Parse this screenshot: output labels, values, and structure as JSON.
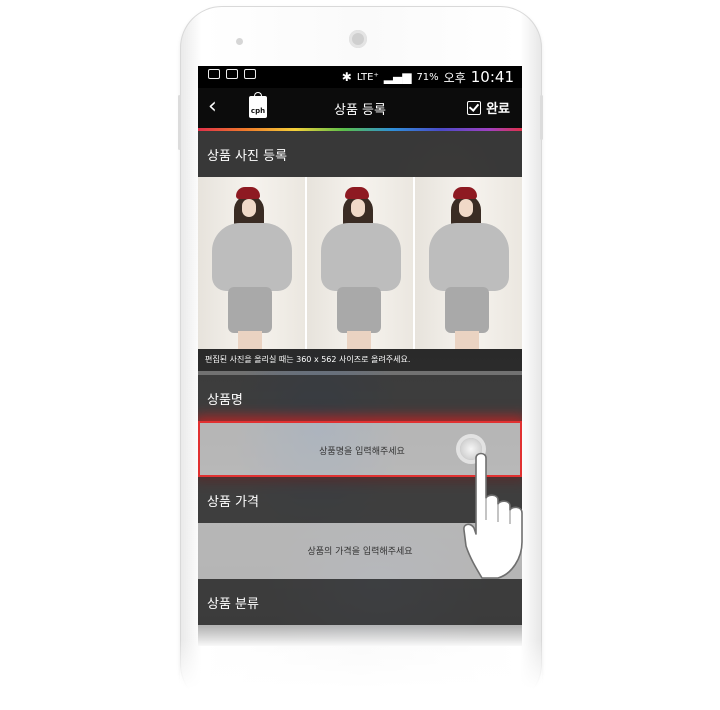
{
  "status_bar": {
    "bluetooth": "✱",
    "network": "LTE⁺",
    "battery": "71%",
    "ampm": "오후",
    "time": "10:41"
  },
  "top_bar": {
    "back_label": "‹",
    "logo_text": "cph",
    "title": "상품 등록",
    "done_label": "완료"
  },
  "sections": {
    "photo_register": "상품 사진 등록",
    "photo_note": "편집된 사진을 올리실 때는 360 x 562 사이즈로 올려주세요.",
    "product_name": "상품명",
    "product_name_placeholder": "상품명을 입력해주세요",
    "product_price": "상품 가격",
    "product_price_placeholder": "상품의 가격을 입력해주세요",
    "product_category": "상품 분류"
  },
  "colors": {
    "accent_highlight": "#e13131",
    "top_bar_bg": "#0c0c0c"
  },
  "icons": [
    "back-icon",
    "shopping-bag-logo",
    "checkbox-icon",
    "touch-indicator",
    "pointing-hand-icon"
  ]
}
